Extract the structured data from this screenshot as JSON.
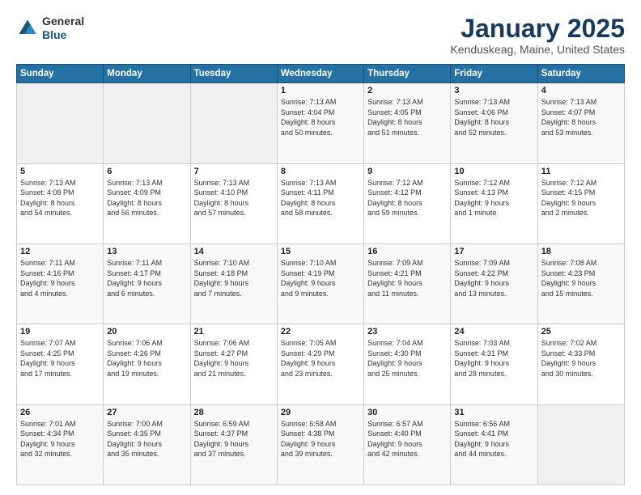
{
  "header": {
    "logo_general": "General",
    "logo_blue": "Blue",
    "month_title": "January 2025",
    "location": "Kenduskeag, Maine, United States"
  },
  "weekdays": [
    "Sunday",
    "Monday",
    "Tuesday",
    "Wednesday",
    "Thursday",
    "Friday",
    "Saturday"
  ],
  "weeks": [
    [
      {
        "day": "",
        "info": ""
      },
      {
        "day": "",
        "info": ""
      },
      {
        "day": "",
        "info": ""
      },
      {
        "day": "1",
        "info": "Sunrise: 7:13 AM\nSunset: 4:04 PM\nDaylight: 8 hours\nand 50 minutes."
      },
      {
        "day": "2",
        "info": "Sunrise: 7:13 AM\nSunset: 4:05 PM\nDaylight: 8 hours\nand 51 minutes."
      },
      {
        "day": "3",
        "info": "Sunrise: 7:13 AM\nSunset: 4:06 PM\nDaylight: 8 hours\nand 52 minutes."
      },
      {
        "day": "4",
        "info": "Sunrise: 7:13 AM\nSunset: 4:07 PM\nDaylight: 8 hours\nand 53 minutes."
      }
    ],
    [
      {
        "day": "5",
        "info": "Sunrise: 7:13 AM\nSunset: 4:08 PM\nDaylight: 8 hours\nand 54 minutes."
      },
      {
        "day": "6",
        "info": "Sunrise: 7:13 AM\nSunset: 4:09 PM\nDaylight: 8 hours\nand 56 minutes."
      },
      {
        "day": "7",
        "info": "Sunrise: 7:13 AM\nSunset: 4:10 PM\nDaylight: 8 hours\nand 57 minutes."
      },
      {
        "day": "8",
        "info": "Sunrise: 7:13 AM\nSunset: 4:11 PM\nDaylight: 8 hours\nand 58 minutes."
      },
      {
        "day": "9",
        "info": "Sunrise: 7:12 AM\nSunset: 4:12 PM\nDaylight: 8 hours\nand 59 minutes."
      },
      {
        "day": "10",
        "info": "Sunrise: 7:12 AM\nSunset: 4:13 PM\nDaylight: 9 hours\nand 1 minute."
      },
      {
        "day": "11",
        "info": "Sunrise: 7:12 AM\nSunset: 4:15 PM\nDaylight: 9 hours\nand 2 minutes."
      }
    ],
    [
      {
        "day": "12",
        "info": "Sunrise: 7:11 AM\nSunset: 4:16 PM\nDaylight: 9 hours\nand 4 minutes."
      },
      {
        "day": "13",
        "info": "Sunrise: 7:11 AM\nSunset: 4:17 PM\nDaylight: 9 hours\nand 6 minutes."
      },
      {
        "day": "14",
        "info": "Sunrise: 7:10 AM\nSunset: 4:18 PM\nDaylight: 9 hours\nand 7 minutes."
      },
      {
        "day": "15",
        "info": "Sunrise: 7:10 AM\nSunset: 4:19 PM\nDaylight: 9 hours\nand 9 minutes."
      },
      {
        "day": "16",
        "info": "Sunrise: 7:09 AM\nSunset: 4:21 PM\nDaylight: 9 hours\nand 11 minutes."
      },
      {
        "day": "17",
        "info": "Sunrise: 7:09 AM\nSunset: 4:22 PM\nDaylight: 9 hours\nand 13 minutes."
      },
      {
        "day": "18",
        "info": "Sunrise: 7:08 AM\nSunset: 4:23 PM\nDaylight: 9 hours\nand 15 minutes."
      }
    ],
    [
      {
        "day": "19",
        "info": "Sunrise: 7:07 AM\nSunset: 4:25 PM\nDaylight: 9 hours\nand 17 minutes."
      },
      {
        "day": "20",
        "info": "Sunrise: 7:06 AM\nSunset: 4:26 PM\nDaylight: 9 hours\nand 19 minutes."
      },
      {
        "day": "21",
        "info": "Sunrise: 7:06 AM\nSunset: 4:27 PM\nDaylight: 9 hours\nand 21 minutes."
      },
      {
        "day": "22",
        "info": "Sunrise: 7:05 AM\nSunset: 4:29 PM\nDaylight: 9 hours\nand 23 minutes."
      },
      {
        "day": "23",
        "info": "Sunrise: 7:04 AM\nSunset: 4:30 PM\nDaylight: 9 hours\nand 25 minutes."
      },
      {
        "day": "24",
        "info": "Sunrise: 7:03 AM\nSunset: 4:31 PM\nDaylight: 9 hours\nand 28 minutes."
      },
      {
        "day": "25",
        "info": "Sunrise: 7:02 AM\nSunset: 4:33 PM\nDaylight: 9 hours\nand 30 minutes."
      }
    ],
    [
      {
        "day": "26",
        "info": "Sunrise: 7:01 AM\nSunset: 4:34 PM\nDaylight: 9 hours\nand 32 minutes."
      },
      {
        "day": "27",
        "info": "Sunrise: 7:00 AM\nSunset: 4:35 PM\nDaylight: 9 hours\nand 35 minutes."
      },
      {
        "day": "28",
        "info": "Sunrise: 6:59 AM\nSunset: 4:37 PM\nDaylight: 9 hours\nand 37 minutes."
      },
      {
        "day": "29",
        "info": "Sunrise: 6:58 AM\nSunset: 4:38 PM\nDaylight: 9 hours\nand 39 minutes."
      },
      {
        "day": "30",
        "info": "Sunrise: 6:57 AM\nSunset: 4:40 PM\nDaylight: 9 hours\nand 42 minutes."
      },
      {
        "day": "31",
        "info": "Sunrise: 6:56 AM\nSunset: 4:41 PM\nDaylight: 9 hours\nand 44 minutes."
      },
      {
        "day": "",
        "info": ""
      }
    ]
  ]
}
